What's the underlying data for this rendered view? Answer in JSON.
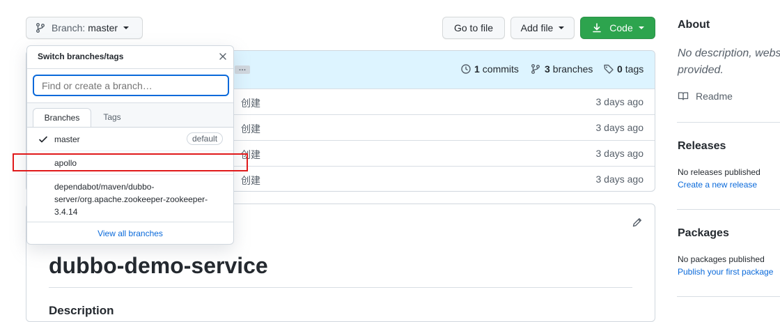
{
  "toolbar": {
    "branch_prefix": "Branch:",
    "branch_name": "master",
    "go_to_file": "Go to file",
    "add_file": "Add file",
    "code": "Code"
  },
  "repo_header": {
    "ellipsis": "…",
    "commits_count": "1",
    "commits_label": "commits",
    "branches_count": "3",
    "branches_label": "branches",
    "tags_count": "0",
    "tags_label": "tags"
  },
  "files": [
    {
      "message": "创建",
      "age": "3 days ago"
    },
    {
      "message": "创建",
      "age": "3 days ago"
    },
    {
      "message": "创建",
      "age": "3 days ago"
    },
    {
      "message": "创建",
      "age": "3 days ago"
    }
  ],
  "readme": {
    "title": "dubbo-demo-service",
    "section": "Description"
  },
  "branch_dropdown": {
    "title": "Switch branches/tags",
    "search_placeholder": "Find or create a branch…",
    "tabs": [
      "Branches",
      "Tags"
    ],
    "branches": [
      {
        "name": "master",
        "badge": "default",
        "selected": true
      },
      {
        "name": "apollo"
      },
      {
        "name_lines": [
          "dependabot/maven/dubbo-",
          "server/org.apache.zookeeper-zookeeper-",
          "3.4.14"
        ]
      }
    ],
    "view_all": "View all branches"
  },
  "sidebar": {
    "about_title": "About",
    "about_desc_line1": "No description, webs",
    "about_desc_line2": "provided.",
    "readme_link": "Readme",
    "releases_title": "Releases",
    "releases_empty": "No releases published",
    "releases_link": "Create a new release",
    "packages_title": "Packages",
    "packages_empty": "No packages published",
    "packages_link": "Publish your first package"
  },
  "colors": {
    "accent_blue": "#0969da",
    "green_button": "#2da44e",
    "highlight_box": "#e0191a"
  }
}
